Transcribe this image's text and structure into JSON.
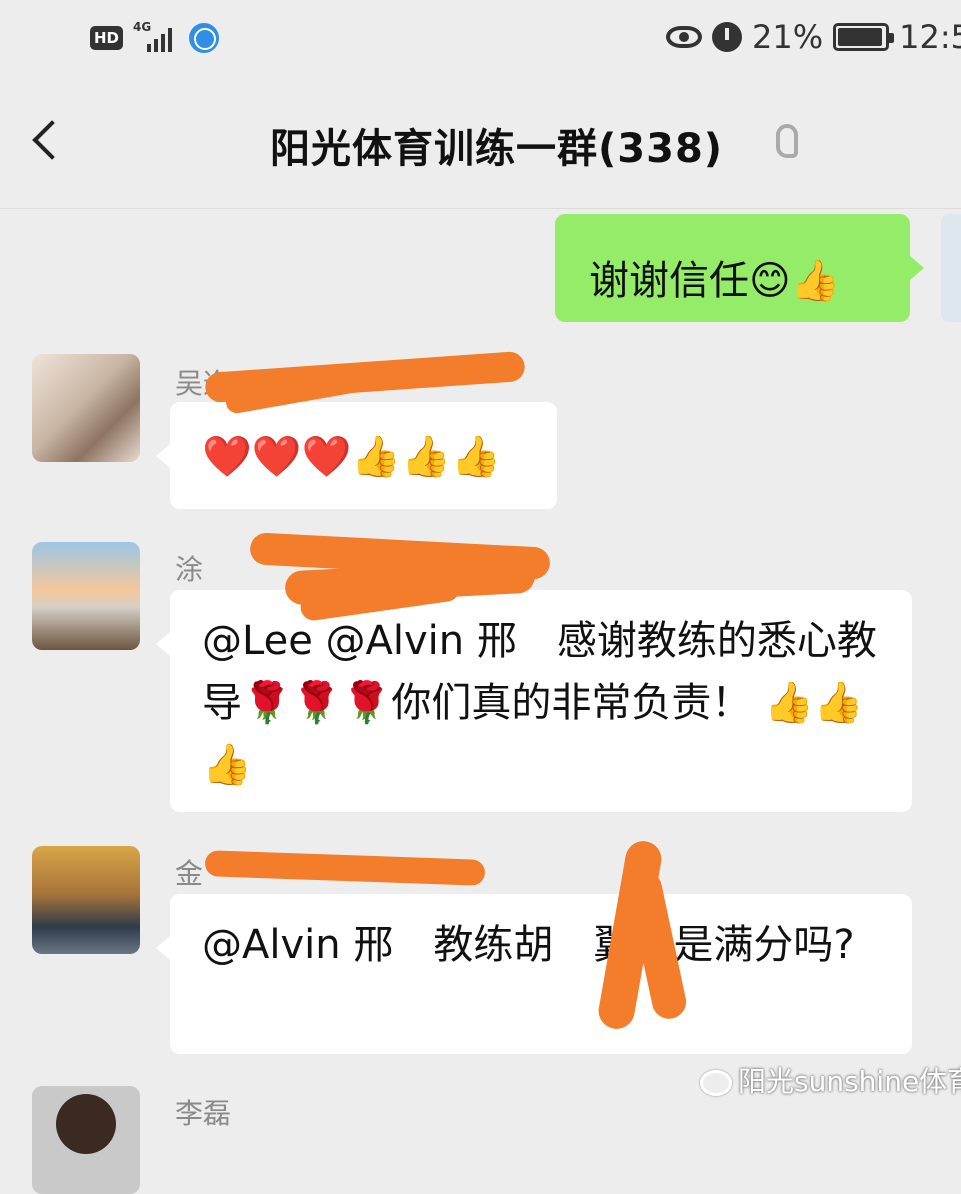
{
  "status_bar": {
    "hd": "HD",
    "network": "4G",
    "battery": "21%",
    "time": "12:5"
  },
  "header": {
    "title": "阳光体育训练一群(338)"
  },
  "messages": [
    {
      "sender": "",
      "text": "谢谢信任😊👍",
      "self": true
    },
    {
      "sender": "吴逸",
      "text": "❤️❤️❤️👍👍👍"
    },
    {
      "sender": "涂",
      "text": "@Lee @Alvin 邢　感谢教练的悉心教导🌹🌹🌹你们真的非常负责！ 👍👍👍"
    },
    {
      "sender": "金",
      "text": "@Alvin 邢　教练胡　翼也是满分吗?"
    },
    {
      "sender": "李磊",
      "text": ""
    }
  ],
  "watermark": "阳光sunshine体育",
  "colors": {
    "background": "#ededed",
    "self_bubble": "#95ec69",
    "other_bubble": "#ffffff",
    "redaction": "#f37d2a"
  }
}
